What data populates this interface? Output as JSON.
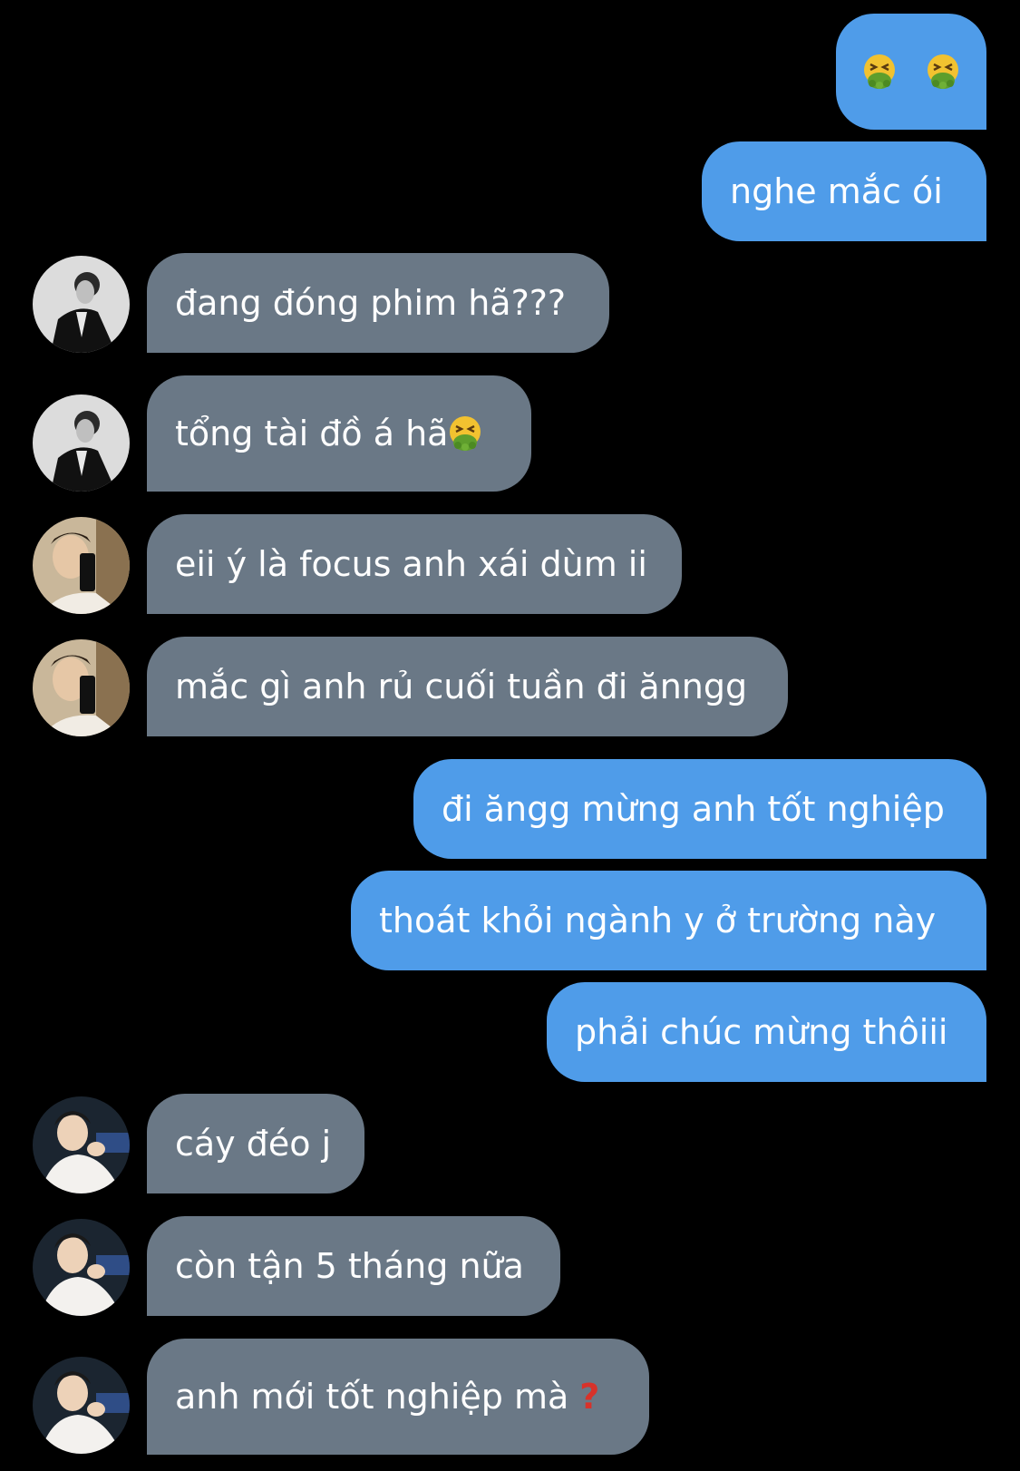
{
  "messages": [
    {
      "side": "out",
      "text": ""
    },
    {
      "side": "out",
      "text": "nghe mắc ói"
    },
    {
      "side": "in",
      "text": "đang đóng phim hã???"
    },
    {
      "side": "in",
      "text": "tổng tài đồ á hã"
    },
    {
      "side": "in",
      "text": "eii ý là focus anh xái dùm ii"
    },
    {
      "side": "in",
      "text": "mắc gì anh rủ cuối tuần đi ănngg"
    },
    {
      "side": "out",
      "text": "đi ăngg mừng anh tốt nghiệp"
    },
    {
      "side": "out",
      "text": "thoát khỏi ngành y ở trường này"
    },
    {
      "side": "out",
      "text": "phải chúc mừng thôiii"
    },
    {
      "side": "in",
      "text": "cáy đéo j"
    },
    {
      "side": "in",
      "text": "còn tận 5 tháng nữa"
    },
    {
      "side": "in",
      "text": "anh mới tốt nghiệp mà"
    }
  ],
  "icons": {
    "vomit": "face-vomiting-icon",
    "question": "question-mark-icon"
  },
  "colors": {
    "background": "#000000",
    "outgoing_bubble": "#4f9ce9",
    "incoming_bubble": "#6a7886",
    "text": "#ffffff",
    "question_mark": "#d8322a"
  }
}
